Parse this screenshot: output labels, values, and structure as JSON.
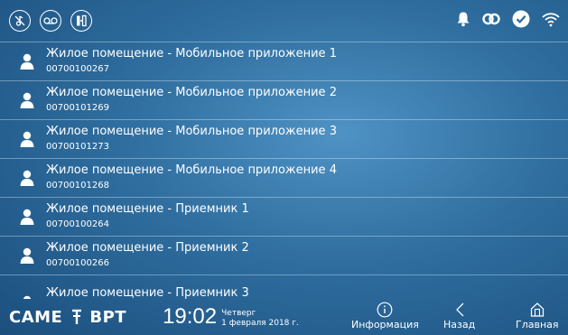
{
  "contacts": [
    {
      "name": "Жилое помещение - Мобильное приложение 1",
      "code": "00700100267"
    },
    {
      "name": "Жилое помещение - Мобильное приложение 2",
      "code": "00700101269"
    },
    {
      "name": "Жилое помещение - Мобильное приложение 3",
      "code": "00700101273"
    },
    {
      "name": "Жилое помещение - Мобильное приложение 4",
      "code": "00700101268"
    },
    {
      "name": "Жилое помещение - Приемник 1",
      "code": "00700100264"
    },
    {
      "name": "Жилое помещение - Приемник 2",
      "code": "00700100266"
    },
    {
      "name": "Жилое помещение - Приемник 3",
      "code": ""
    }
  ],
  "footer": {
    "brand_came": "CAME",
    "brand_bpt": "BPT",
    "time": "19:02",
    "weekday": "Четверг",
    "date": "1 февраля 2018 г.",
    "info_label": "Информация",
    "back_label": "Назад",
    "home_label": "Главная"
  },
  "status_icons": [
    "mute-ringer-icon",
    "answering-machine-icon",
    "door-opener-icon",
    "bell-icon",
    "link-icon",
    "check-icon",
    "wifi-icon"
  ]
}
